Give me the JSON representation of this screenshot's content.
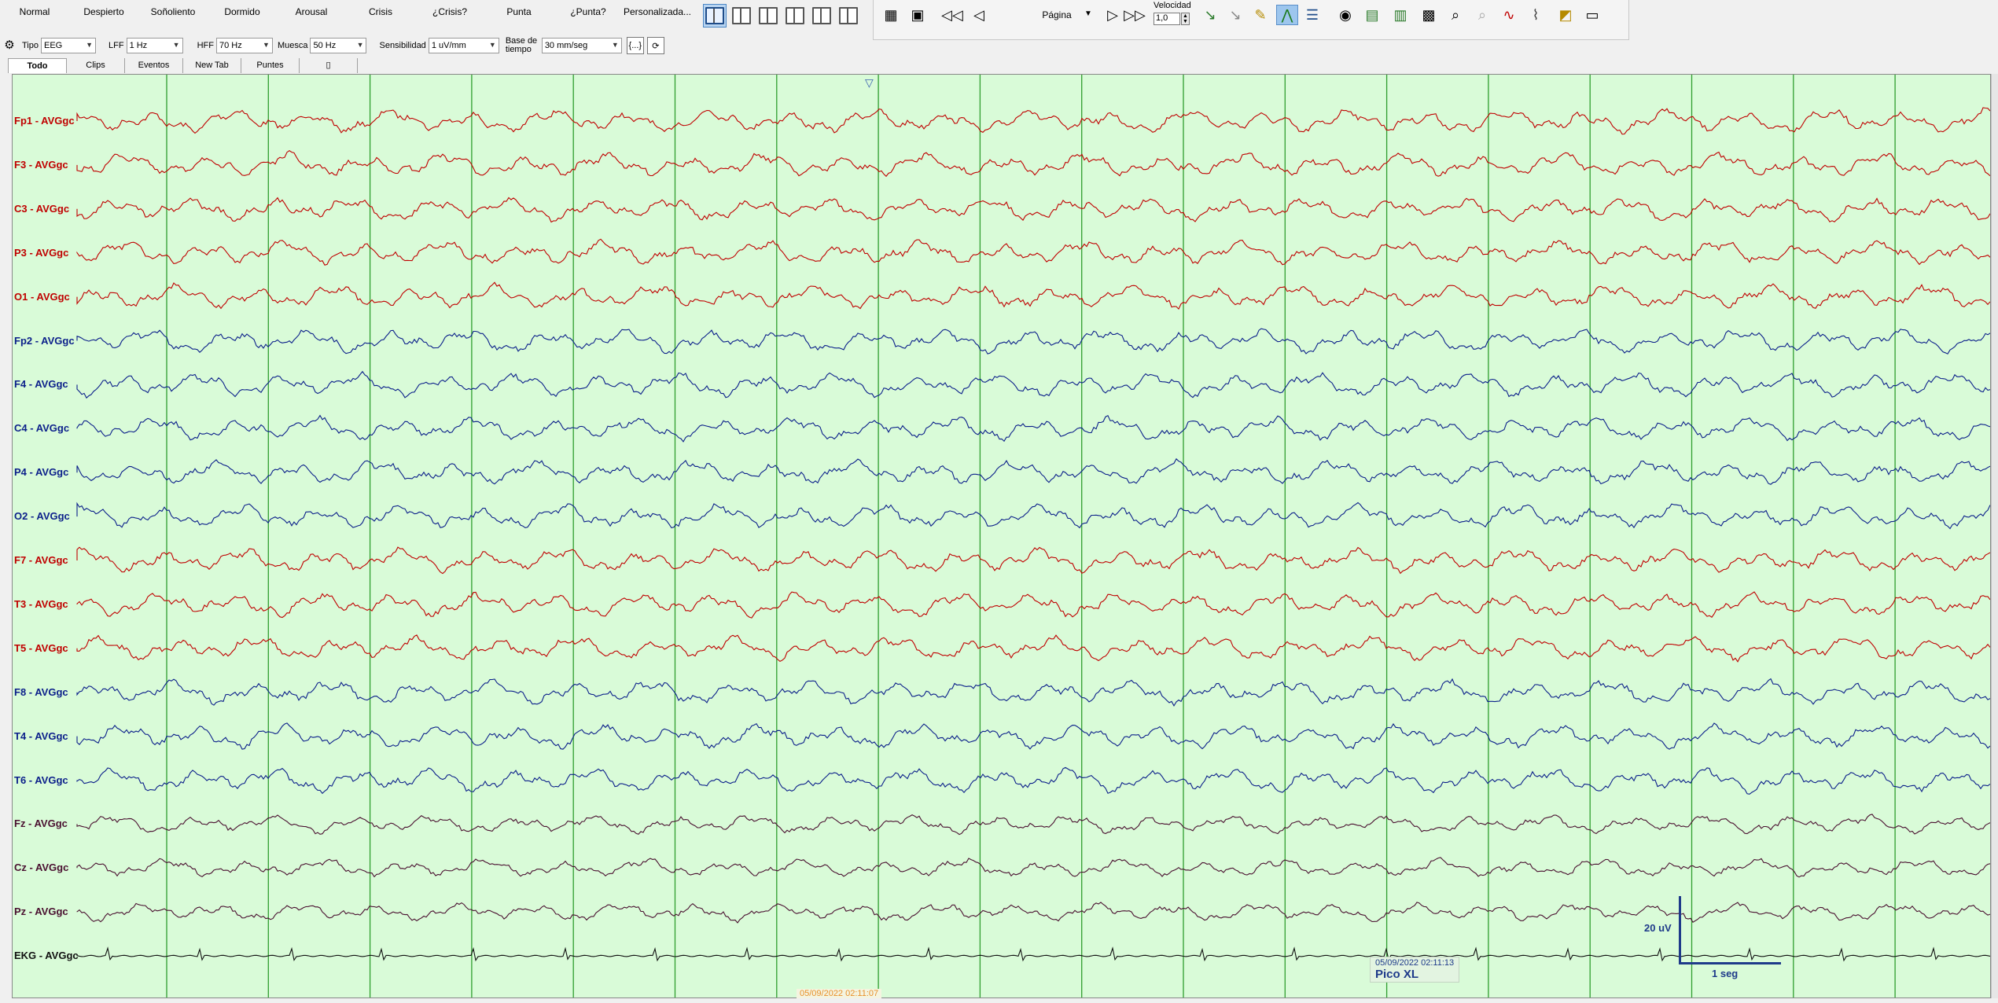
{
  "event_buttons": [
    "Normal",
    "Despierto",
    "Soñoliento",
    "Dormido",
    "Arousal",
    "Crisis",
    "¿Crisis?",
    "Punta",
    "¿Punta?",
    "Personalizada..."
  ],
  "toolbar": {
    "page_select": "Página",
    "speed_label": "Velocidad",
    "speed_value": "1,0"
  },
  "settings": {
    "tipo_label": "Tipo",
    "tipo_value": "EEG",
    "lff_label": "LFF",
    "lff_value": "1 Hz",
    "hff_label": "HFF",
    "hff_value": "70 Hz",
    "muesca_label": "Muesca",
    "muesca_value": "50 Hz",
    "sens_label": "Sensibilidad",
    "sens_value": "1 uV/mm",
    "base_label": "Base de tiempo",
    "base_value": "30 mm/seg",
    "bracket_button": "{...}"
  },
  "tabs": [
    "Todo",
    "Clips",
    "Eventos",
    "New Tab",
    "Puntes"
  ],
  "channels": [
    {
      "name": "Fp1 - AVGgc",
      "color": "#c00000"
    },
    {
      "name": "F3 - AVGgc",
      "color": "#c00000"
    },
    {
      "name": "C3 - AVGgc",
      "color": "#c00000"
    },
    {
      "name": "P3 - AVGgc",
      "color": "#c00000"
    },
    {
      "name": "O1 - AVGgc",
      "color": "#c00000"
    },
    {
      "name": "Fp2 - AVGgc",
      "color": "#0b1f8a"
    },
    {
      "name": "F4 - AVGgc",
      "color": "#0b1f8a"
    },
    {
      "name": "C4 - AVGgc",
      "color": "#0b1f8a"
    },
    {
      "name": "P4 - AVGgc",
      "color": "#0b1f8a"
    },
    {
      "name": "O2 - AVGgc",
      "color": "#0b1f8a"
    },
    {
      "name": "F7 - AVGgc",
      "color": "#c00000"
    },
    {
      "name": "T3 - AVGgc",
      "color": "#c00000"
    },
    {
      "name": "T5 - AVGgc",
      "color": "#c00000"
    },
    {
      "name": "F8 - AVGgc",
      "color": "#0b1f8a"
    },
    {
      "name": "T4 - AVGgc",
      "color": "#0b1f8a"
    },
    {
      "name": "T6 - AVGgc",
      "color": "#0b1f8a"
    },
    {
      "name": "Fz - AVGgc",
      "color": "#4a1030"
    },
    {
      "name": "Cz - AVGgc",
      "color": "#4a1030"
    },
    {
      "name": "Pz - AVGgc",
      "color": "#4a1030"
    },
    {
      "name": "EKG - AVGgc",
      "color": "#111111"
    }
  ],
  "event_marker": {
    "time": "05/09/2022 02:11:13",
    "name": "Pico XL"
  },
  "bottom_time": "05/09/2022 02:11:07",
  "calibration": {
    "amplitude": "20 uV",
    "duration": "1 seg"
  },
  "colors": {
    "background": "#d9fbd8",
    "grid_line": "#2f9e2f",
    "accent": "#1e3a8a"
  }
}
